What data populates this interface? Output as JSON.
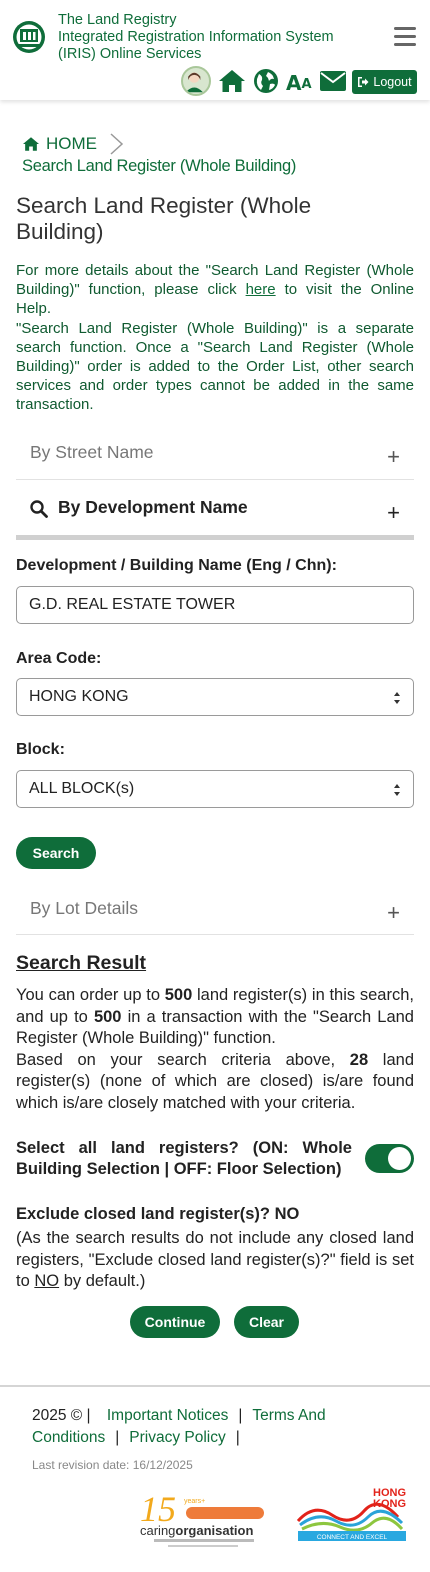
{
  "header": {
    "title_lines": [
      "The Land Registry",
      "Integrated Registration Information System",
      "(IRIS) Online Services"
    ],
    "logout_label": "Logout",
    "icons": [
      "avatar-icon",
      "home-icon",
      "globe-icon",
      "font-size-icon",
      "mail-icon",
      "logout-icon",
      "menu-icon"
    ],
    "font_size_label": "AA"
  },
  "breadcrumb": {
    "home": "HOME",
    "current": "Search Land Register (Whole Building)"
  },
  "page": {
    "title": "Search Land Register (Whole Building)",
    "intro_part1": "For more details about the \"Search Land Register (Whole Building)\" function, please click ",
    "intro_link": "here",
    "intro_part2": " to visit the Online Help.",
    "intro_para2": "\"Search Land Register (Whole Building)\" is a separate search function. Once a \"Search Land Register (Whole Building)\" order is added to the Order List, other search services and order types cannot be added in the same transaction."
  },
  "accordion": {
    "street": "By Street Name",
    "development": "By Development Name",
    "lot": "By Lot Details",
    "plus": "+"
  },
  "form": {
    "dev_label": "Development / Building Name (Eng / Chn):",
    "dev_value": "G.D. REAL ESTATE TOWER",
    "area_label": "Area Code:",
    "area_value": "HONG KONG",
    "block_label": "Block:",
    "block_value": "ALL BLOCK(s)",
    "search_button": "Search"
  },
  "result": {
    "title": "Search Result",
    "p1_a": "You can order up to ",
    "p1_max1": "500",
    "p1_b": " land register(s) in this search, and up to ",
    "p1_max2": "500",
    "p1_c": " in a transaction with the \"Search Land Register (Whole Building)\" function.",
    "p2_a": "Based on your search criteria above, ",
    "p2_count": "28",
    "p2_b": " land register(s) (none of which are closed) is/are found which is/are closely matched with your criteria.",
    "toggle_label": "Select all land registers? (ON: Whole Building Selection | OFF: Floor Selection)",
    "toggle_on": true,
    "exclude_label": "Exclude closed land register(s)?  NO",
    "exclude_note_a": "(As the search results do not include any closed land registers, \"Exclude closed land register(s)?\" field is set to ",
    "exclude_note_no": "NO",
    "exclude_note_b": " by default.)",
    "continue_button": "Continue",
    "clear_button": "Clear"
  },
  "footer": {
    "copyright": "2025 © |",
    "important_notices": "Important Notices",
    "terms": "Terms And Conditions",
    "privacy": "Privacy Policy",
    "sep": "|",
    "revision": "Last revision date: 16/12/2025",
    "caring_years": "15",
    "caring_years_suffix": "years+",
    "caring_text_a": "caring",
    "caring_text_b": "organisation",
    "hk_brand_a": "HONG",
    "hk_brand_b": "KONG",
    "hk_tagline": "CONNECT AND EXCEL"
  },
  "colors": {
    "brand_green": "#0f6d3a",
    "text_dark": "#222222",
    "muted": "#777777"
  }
}
